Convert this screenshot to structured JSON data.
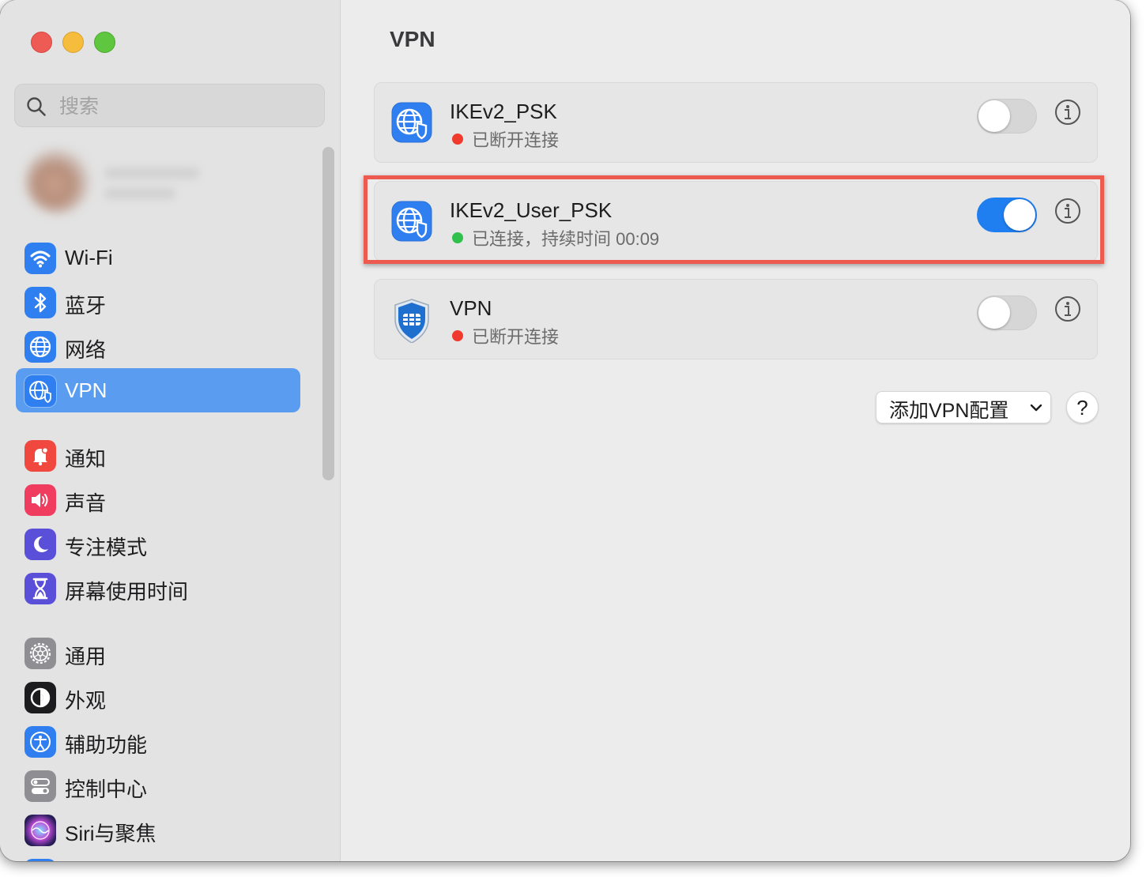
{
  "window": {
    "title": "VPN",
    "traffic_lights": [
      "close",
      "minimize",
      "maximize"
    ]
  },
  "sidebar": {
    "search": {
      "placeholder": "搜索",
      "value": ""
    },
    "selected": "VPN",
    "items": [
      {
        "label": "Wi-Fi",
        "icon": "wifi-icon",
        "color": "#2f7ff0"
      },
      {
        "label": "蓝牙",
        "icon": "bluetooth-icon",
        "color": "#2f7ff0"
      },
      {
        "label": "网络",
        "icon": "globe-icon",
        "color": "#2f7ff0"
      },
      {
        "label": "VPN",
        "icon": "vpn-globe-shield-icon",
        "color": "#2f7ff0"
      },
      {
        "label": "通知",
        "icon": "bell-icon",
        "color": "#f0473f"
      },
      {
        "label": "声音",
        "icon": "speaker-icon",
        "color": "#f03c5f"
      },
      {
        "label": "专注模式",
        "icon": "moon-icon",
        "color": "#5a4fd8"
      },
      {
        "label": "屏幕使用时间",
        "icon": "hourglass-icon",
        "color": "#5a4fd8"
      },
      {
        "label": "通用",
        "icon": "gear-icon",
        "color": "#8e8e93"
      },
      {
        "label": "外观",
        "icon": "appearance-icon",
        "color": "#1c1c1e"
      },
      {
        "label": "辅助功能",
        "icon": "accessibility-icon",
        "color": "#2f7ff0"
      },
      {
        "label": "控制中心",
        "icon": "control-center-icon",
        "color": "#8e8e93"
      },
      {
        "label": "Siri与聚焦",
        "icon": "siri-icon",
        "color": "#3a3a8c"
      }
    ]
  },
  "main": {
    "title": "VPN",
    "vpns": [
      {
        "name": "IKEv2_PSK",
        "status": "已断开连接",
        "status_color": "#f03a2e",
        "enabled": false,
        "icon": "vpn-globe-shield-icon"
      },
      {
        "name": "IKEv2_User_PSK",
        "status": "已连接，持续时间 00:09",
        "status_color": "#30c14c",
        "enabled": true,
        "icon": "vpn-globe-shield-icon"
      },
      {
        "name": "VPN",
        "status": "已断开连接",
        "status_color": "#f03a2e",
        "enabled": false,
        "icon": "fortinet-shield-icon"
      }
    ],
    "add_button": "添加VPN配置",
    "help_button": "?"
  },
  "colors": {
    "accent": "#1f7ff1",
    "selection": "#5a9df0",
    "highlight_border": "#ec5a50"
  }
}
